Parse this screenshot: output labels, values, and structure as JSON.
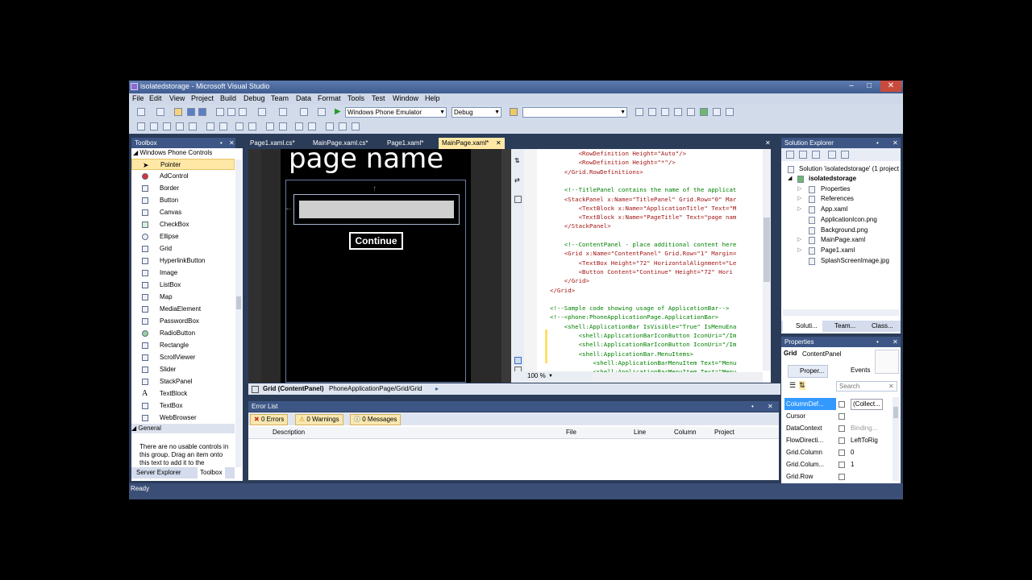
{
  "window": {
    "title": "isolatedstorage - Microsoft Visual Studio",
    "controls": [
      "minimize-icon",
      "maximize-icon",
      "close-icon"
    ]
  },
  "menu": [
    "File",
    "Edit",
    "View",
    "Project",
    "Build",
    "Debug",
    "Team",
    "Data",
    "Format",
    "Tools",
    "Test",
    "Window",
    "Help"
  ],
  "toolbar": {
    "target_device": "Windows Phone Emulator",
    "configuration": "Debug",
    "find_value": ""
  },
  "toolbox": {
    "title": "Toolbox",
    "group1": "Windows Phone Controls",
    "items": [
      "Pointer",
      "AdControl",
      "Border",
      "Button",
      "Canvas",
      "CheckBox",
      "Ellipse",
      "Grid",
      "HyperlinkButton",
      "Image",
      "ListBox",
      "Map",
      "MediaElement",
      "PasswordBox",
      "RadioButton",
      "Rectangle",
      "ScrollViewer",
      "Slider",
      "StackPanel",
      "TextBlock",
      "TextBox",
      "WebBrowser"
    ],
    "group2": "General",
    "empty_text": "There are no usable controls in this group. Drag an item onto this text to add it to the",
    "bottom_tabs": [
      "Server Explorer",
      "Toolbox"
    ]
  },
  "doc_tabs": [
    "Page1.xaml.cs*",
    "MainPage.xaml.cs*",
    "Page1.xaml*",
    "MainPage.xaml*"
  ],
  "designer": {
    "page_name": "page name",
    "button_label": "Continue",
    "zoom": "100 %",
    "breadcrumb_element": "Grid (ContentPanel)",
    "breadcrumb_path": "PhoneApplicationPage/Grid/Grid"
  },
  "code_lines": [
    {
      "t": "        <RowDefinition Height=\"Auto\"/>",
      "c": "#a31515"
    },
    {
      "t": "        <RowDefinition Height=\"*\"/>",
      "c": "#a31515"
    },
    {
      "t": "    </Grid.RowDefinitions>",
      "c": "#a31515"
    },
    {
      "t": "",
      "c": "#000"
    },
    {
      "t": "    <!--TitlePanel contains the name of the applicat",
      "c": "#008000"
    },
    {
      "t": "    <StackPanel x:Name=\"TitlePanel\" Grid.Row=\"0\" Mar",
      "c": "#a31515"
    },
    {
      "t": "        <TextBlock x:Name=\"ApplicationTitle\" Text=\"M",
      "c": "#a31515"
    },
    {
      "t": "        <TextBlock x:Name=\"PageTitle\" Text=\"page nam",
      "c": "#a31515"
    },
    {
      "t": "    </StackPanel>",
      "c": "#a31515"
    },
    {
      "t": "",
      "c": "#000"
    },
    {
      "t": "    <!--ContentPanel - place additional content here",
      "c": "#008000"
    },
    {
      "t": "    <Grid x:Name=\"ContentPanel\" Grid.Row=\"1\" Margin=",
      "c": "#a31515"
    },
    {
      "t": "        <TextBox Height=\"72\" HorizontalAlignment=\"Le",
      "c": "#a31515"
    },
    {
      "t": "        <Button Content=\"Continue\" Height=\"72\" Hori",
      "c": "#a31515"
    },
    {
      "t": "    </Grid>",
      "c": "#a31515"
    },
    {
      "t": "</Grid>",
      "c": "#a31515"
    },
    {
      "t": "",
      "c": "#000"
    },
    {
      "t": "<!--Sample code showing usage of ApplicationBar-->",
      "c": "#008000"
    },
    {
      "t": "<!--<phone:PhoneApplicationPage.ApplicationBar>",
      "c": "#008000"
    },
    {
      "t": "    <shell:ApplicationBar IsVisible=\"True\" IsMenuEna",
      "c": "#008000"
    },
    {
      "t": "        <shell:ApplicationBarIconButton IconUri=\"/Im",
      "c": "#008000"
    },
    {
      "t": "        <shell:ApplicationBarIconButton IconUri=\"/Im",
      "c": "#008000"
    },
    {
      "t": "        <shell:ApplicationBar.MenuItems>",
      "c": "#008000"
    },
    {
      "t": "            <shell:ApplicationBarMenuItem Text=\"Menu",
      "c": "#008000"
    },
    {
      "t": "            <shell:ApplicationBarMenuItem Text=\"Menu",
      "c": "#008000"
    }
  ],
  "solution_explorer": {
    "title": "Solution Explorer",
    "solution": "Solution 'isolatedstorage' (1 project",
    "project": "isolatedstorage",
    "items": [
      "Properties",
      "References",
      "App.xaml",
      "ApplicationIcon.png",
      "Background.png",
      "MainPage.xaml",
      "Page1.xaml",
      "SplashScreenImage.jpg"
    ],
    "tabs": [
      "Soluti...",
      "Team...",
      "Class..."
    ]
  },
  "properties": {
    "title": "Properties",
    "element_type": "Grid",
    "element_name": "ContentPanel",
    "tab_properties": "Proper...",
    "tab_events": "Events",
    "search_placeholder": "Search",
    "rows": [
      {
        "name": "ColumnDef...",
        "value": "(Collect..."
      },
      {
        "name": "Cursor",
        "value": ""
      },
      {
        "name": "DataContext",
        "value": "Binding..."
      },
      {
        "name": "FlowDirecti...",
        "value": "LeftToRig"
      },
      {
        "name": "Grid.Column",
        "value": "0"
      },
      {
        "name": "Grid.Colum...",
        "value": "1"
      },
      {
        "name": "Grid.Row",
        "value": ""
      }
    ]
  },
  "error_list": {
    "title": "Error List",
    "errors": "0 Errors",
    "warnings": "0 Warnings",
    "messages": "0 Messages",
    "columns": [
      "Description",
      "File",
      "Line",
      "Column",
      "Project"
    ]
  },
  "status": "Ready",
  "colors": {
    "vs_blue": "#2b3c59",
    "selection": "#ffe8a6",
    "designer_bg": "#000000"
  }
}
